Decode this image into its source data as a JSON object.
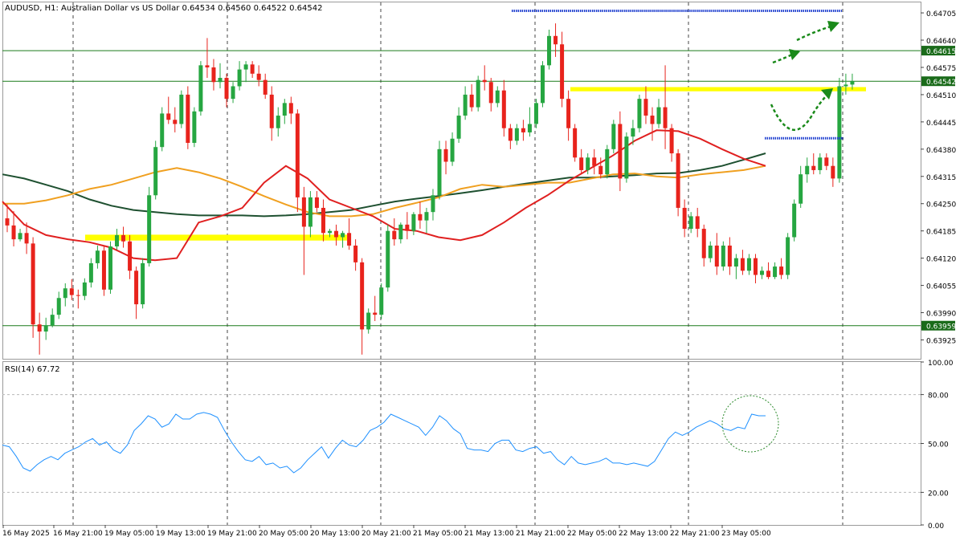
{
  "header": {
    "symbol_line": "AUDUSD, H1:  Australian Dollar vs US Dollar  0.64534 0.64560 0.64522 0.64542"
  },
  "rsi": {
    "label": "RSI(14) 67.72",
    "axis_ticks": [
      "100.00",
      "80.00",
      "50.00",
      "20.00",
      "0.00"
    ]
  },
  "price_axis": {
    "ticks": [
      "0.64705",
      "0.64640",
      "0.64575",
      "0.64510",
      "0.64445",
      "0.64380",
      "0.64315",
      "0.64250",
      "0.64185",
      "0.64120",
      "0.64055",
      "0.63990",
      "0.63925"
    ],
    "badges": [
      "0.64615",
      "0.64542",
      "0.63959"
    ]
  },
  "time_axis": {
    "labels": [
      "16 May 2025",
      "16 May 21:00",
      "19 May 05:00",
      "19 May 13:00",
      "19 May 21:00",
      "20 May 05:00",
      "20 May 13:00",
      "20 May 21:00",
      "21 May 05:00",
      "21 May 13:00",
      "21 May 21:00",
      "22 May 05:00",
      "22 May 13:00",
      "22 May 21:00",
      "23 May 05:00"
    ]
  },
  "colors": {
    "bull": "#26a641",
    "bear": "#e8231c",
    "ma_fast": "#e02020",
    "ma_mid": "#f0a020",
    "ma_slow": "#1e5030",
    "rsi_line": "#1e90ff",
    "zone": "#ffff00",
    "arrow": "#1a8a1a",
    "hline": "#1a7a1a"
  },
  "chart_data": {
    "type": "candlestick",
    "title": "AUDUSD, H1: Australian Dollar vs US Dollar",
    "last_ohlc": {
      "open": 0.64534,
      "high": 0.6456,
      "low": 0.64522,
      "close": 0.64542
    },
    "ylim": [
      0.6388,
      0.6473
    ],
    "horizontal_levels": [
      0.64615,
      0.64542,
      0.63959
    ],
    "candles": [
      [
        0.64215,
        0.64248,
        0.64182,
        0.64198
      ],
      [
        0.64198,
        0.64232,
        0.64148,
        0.64165
      ],
      [
        0.64165,
        0.6419,
        0.6416,
        0.6418
      ],
      [
        0.6418,
        0.64205,
        0.6413,
        0.64155
      ],
      [
        0.64155,
        0.6417,
        0.6393,
        0.63962
      ],
      [
        0.63962,
        0.6399,
        0.6389,
        0.63945
      ],
      [
        0.63945,
        0.63978,
        0.63925,
        0.6396
      ],
      [
        0.6396,
        0.64,
        0.63955,
        0.63985
      ],
      [
        0.63985,
        0.6404,
        0.63975,
        0.64025
      ],
      [
        0.64025,
        0.6406,
        0.64005,
        0.64048
      ],
      [
        0.64048,
        0.6407,
        0.6402,
        0.64032
      ],
      [
        0.64032,
        0.64045,
        0.64,
        0.6403
      ],
      [
        0.6403,
        0.64072,
        0.6402,
        0.64062
      ],
      [
        0.64062,
        0.6412,
        0.6405,
        0.64108
      ],
      [
        0.64108,
        0.6415,
        0.64095,
        0.64138
      ],
      [
        0.64138,
        0.6415,
        0.6403,
        0.64045
      ],
      [
        0.64045,
        0.6416,
        0.64035,
        0.64148
      ],
      [
        0.64148,
        0.6419,
        0.6414,
        0.64175
      ],
      [
        0.64175,
        0.64195,
        0.64145,
        0.6416
      ],
      [
        0.6416,
        0.64175,
        0.6407,
        0.6409
      ],
      [
        0.6409,
        0.641,
        0.63975,
        0.6401
      ],
      [
        0.6401,
        0.6412,
        0.64,
        0.64108
      ],
      [
        0.64108,
        0.6429,
        0.641,
        0.6427
      ],
      [
        0.6427,
        0.644,
        0.6426,
        0.64385
      ],
      [
        0.64385,
        0.6448,
        0.64375,
        0.64465
      ],
      [
        0.64465,
        0.64505,
        0.6444,
        0.6445
      ],
      [
        0.6445,
        0.6448,
        0.6442,
        0.6444
      ],
      [
        0.6444,
        0.6452,
        0.6443,
        0.6451
      ],
      [
        0.6451,
        0.6453,
        0.6438,
        0.64395
      ],
      [
        0.64395,
        0.6448,
        0.64385,
        0.6447
      ],
      [
        0.6447,
        0.6459,
        0.6446,
        0.6458
      ],
      [
        0.6458,
        0.64645,
        0.6455,
        0.64575
      ],
      [
        0.64575,
        0.64595,
        0.6452,
        0.6454
      ],
      [
        0.6454,
        0.64585,
        0.64525,
        0.6455
      ],
      [
        0.6455,
        0.6456,
        0.6448,
        0.645
      ],
      [
        0.645,
        0.6454,
        0.6449,
        0.6453
      ],
      [
        0.6453,
        0.6459,
        0.6452,
        0.6457
      ],
      [
        0.6457,
        0.6459,
        0.6454,
        0.64582
      ],
      [
        0.64582,
        0.6459,
        0.6455,
        0.6456
      ],
      [
        0.6456,
        0.6458,
        0.6453,
        0.64545
      ],
      [
        0.64545,
        0.6456,
        0.645,
        0.6451
      ],
      [
        0.6451,
        0.6453,
        0.644,
        0.6443
      ],
      [
        0.6443,
        0.6448,
        0.6441,
        0.6446
      ],
      [
        0.6446,
        0.645,
        0.6444,
        0.6449
      ],
      [
        0.6449,
        0.64505,
        0.6444,
        0.64465
      ],
      [
        0.64465,
        0.64475,
        0.6423,
        0.64265
      ],
      [
        0.64265,
        0.6429,
        0.6408,
        0.64195
      ],
      [
        0.64195,
        0.6428,
        0.6417,
        0.64265
      ],
      [
        0.64265,
        0.6428,
        0.6423,
        0.6424
      ],
      [
        0.6424,
        0.6426,
        0.6416,
        0.6418
      ],
      [
        0.6418,
        0.6419,
        0.6417,
        0.64185
      ],
      [
        0.64185,
        0.642,
        0.6415,
        0.6417
      ],
      [
        0.6417,
        0.64185,
        0.64145,
        0.6418
      ],
      [
        0.6418,
        0.64215,
        0.6414,
        0.6415
      ],
      [
        0.6415,
        0.64165,
        0.6409,
        0.6411
      ],
      [
        0.6411,
        0.6412,
        0.6389,
        0.6395
      ],
      [
        0.6395,
        0.64,
        0.6394,
        0.6399
      ],
      [
        0.6399,
        0.6403,
        0.6397,
        0.63985
      ],
      [
        0.63985,
        0.6406,
        0.63975,
        0.6405
      ],
      [
        0.6405,
        0.642,
        0.6404,
        0.64185
      ],
      [
        0.64185,
        0.64215,
        0.6415,
        0.64165
      ],
      [
        0.64165,
        0.64205,
        0.64155,
        0.642
      ],
      [
        0.642,
        0.6423,
        0.64165,
        0.64185
      ],
      [
        0.64185,
        0.6423,
        0.64175,
        0.64225
      ],
      [
        0.64225,
        0.64255,
        0.6419,
        0.6421
      ],
      [
        0.6421,
        0.6424,
        0.6418,
        0.6423
      ],
      [
        0.6423,
        0.64285,
        0.6421,
        0.6427
      ],
      [
        0.6427,
        0.644,
        0.6426,
        0.6438
      ],
      [
        0.6438,
        0.644,
        0.6432,
        0.6435
      ],
      [
        0.6435,
        0.6442,
        0.6434,
        0.64405
      ],
      [
        0.64405,
        0.6448,
        0.64395,
        0.6446
      ],
      [
        0.6446,
        0.6453,
        0.6445,
        0.6451
      ],
      [
        0.6451,
        0.64535,
        0.6447,
        0.6448
      ],
      [
        0.6448,
        0.64555,
        0.6447,
        0.64545
      ],
      [
        0.64545,
        0.6458,
        0.6452,
        0.6454
      ],
      [
        0.6454,
        0.6455,
        0.6447,
        0.6449
      ],
      [
        0.6449,
        0.6453,
        0.6448,
        0.6452
      ],
      [
        0.6452,
        0.64545,
        0.6441,
        0.6443
      ],
      [
        0.6443,
        0.6444,
        0.6438,
        0.644
      ],
      [
        0.644,
        0.6444,
        0.6439,
        0.6443
      ],
      [
        0.6443,
        0.6445,
        0.644,
        0.6442
      ],
      [
        0.6442,
        0.6448,
        0.6441,
        0.6444
      ],
      [
        0.6444,
        0.645,
        0.6443,
        0.6449
      ],
      [
        0.6449,
        0.6459,
        0.6448,
        0.6458
      ],
      [
        0.6458,
        0.64665,
        0.6457,
        0.6465
      ],
      [
        0.6465,
        0.6468,
        0.646,
        0.6463
      ],
      [
        0.6463,
        0.6466,
        0.6448,
        0.645
      ],
      [
        0.645,
        0.6452,
        0.644,
        0.6443
      ],
      [
        0.6443,
        0.6444,
        0.6435,
        0.6436
      ],
      [
        0.6436,
        0.6438,
        0.6432,
        0.6433
      ],
      [
        0.6433,
        0.6437,
        0.6432,
        0.6436
      ],
      [
        0.6436,
        0.6438,
        0.6432,
        0.6434
      ],
      [
        0.6434,
        0.6436,
        0.6431,
        0.6432
      ],
      [
        0.6432,
        0.6439,
        0.6431,
        0.6438
      ],
      [
        0.6438,
        0.6445,
        0.6437,
        0.6444
      ],
      [
        0.6444,
        0.6447,
        0.6428,
        0.6431
      ],
      [
        0.6431,
        0.6442,
        0.643,
        0.6441
      ],
      [
        0.6441,
        0.6445,
        0.6439,
        0.6443
      ],
      [
        0.6443,
        0.6451,
        0.6442,
        0.645
      ],
      [
        0.645,
        0.6453,
        0.6444,
        0.6446
      ],
      [
        0.6446,
        0.6448,
        0.644,
        0.6444
      ],
      [
        0.6444,
        0.645,
        0.6443,
        0.6448
      ],
      [
        0.6448,
        0.6458,
        0.6438,
        0.6443
      ],
      [
        0.6443,
        0.6444,
        0.6435,
        0.6437
      ],
      [
        0.6437,
        0.6438,
        0.6422,
        0.6424
      ],
      [
        0.6424,
        0.6426,
        0.6417,
        0.6419
      ],
      [
        0.6419,
        0.6423,
        0.6418,
        0.6422
      ],
      [
        0.6422,
        0.6424,
        0.6417,
        0.6419
      ],
      [
        0.6419,
        0.642,
        0.641,
        0.6412
      ],
      [
        0.6412,
        0.6416,
        0.6411,
        0.6415
      ],
      [
        0.6415,
        0.6418,
        0.6408,
        0.641
      ],
      [
        0.641,
        0.6416,
        0.6409,
        0.6415
      ],
      [
        0.6415,
        0.6417,
        0.6408,
        0.641
      ],
      [
        0.641,
        0.6413,
        0.6407,
        0.6412
      ],
      [
        0.6412,
        0.6414,
        0.6408,
        0.6409
      ],
      [
        0.6409,
        0.6413,
        0.6408,
        0.6412
      ],
      [
        0.6412,
        0.6413,
        0.6406,
        0.6408
      ],
      [
        0.6408,
        0.641,
        0.6407,
        0.6409
      ],
      [
        0.6409,
        0.6411,
        0.6407,
        0.64075
      ],
      [
        0.64075,
        0.6411,
        0.6407,
        0.641
      ],
      [
        0.641,
        0.6412,
        0.6407,
        0.6408
      ],
      [
        0.6408,
        0.6418,
        0.6407,
        0.6417
      ],
      [
        0.6417,
        0.6426,
        0.6416,
        0.6425
      ],
      [
        0.6425,
        0.6434,
        0.6424,
        0.6432
      ],
      [
        0.6432,
        0.6436,
        0.643,
        0.6434
      ],
      [
        0.6434,
        0.6437,
        0.6432,
        0.6433
      ],
      [
        0.6433,
        0.6437,
        0.6432,
        0.6436
      ],
      [
        0.6436,
        0.6437,
        0.6433,
        0.6434
      ],
      [
        0.6434,
        0.6436,
        0.6429,
        0.6431
      ],
      [
        0.6431,
        0.6455,
        0.643,
        0.6453
      ],
      [
        0.6453,
        0.6456,
        0.6451,
        0.64534
      ],
      [
        0.64534,
        0.6456,
        0.64522,
        0.64542
      ]
    ],
    "ma_fast": [
      0.64255,
      0.642,
      0.64175,
      0.64165,
      0.64158,
      0.64145,
      0.6412,
      0.64115,
      0.6412,
      0.64205,
      0.6422,
      0.6424,
      0.643,
      0.6434,
      0.6431,
      0.6426,
      0.6424,
      0.6422,
      0.6419,
      0.64185,
      0.6417,
      0.64163,
      0.64175,
      0.64205,
      0.6424,
      0.6427,
      0.64305,
      0.64335,
      0.64365,
      0.644,
      0.64425,
      0.64423,
      0.64405,
      0.6438,
      0.64357,
      0.6434
    ],
    "ma_mid": [
      0.6425,
      0.6425,
      0.64258,
      0.6427,
      0.64285,
      0.64295,
      0.6431,
      0.64325,
      0.64335,
      0.64325,
      0.6431,
      0.6429,
      0.64268,
      0.64248,
      0.6423,
      0.6422,
      0.6422,
      0.64225,
      0.6424,
      0.64252,
      0.64265,
      0.64285,
      0.64295,
      0.6429,
      0.64295,
      0.643,
      0.643,
      0.6431,
      0.6432,
      0.64322,
      0.64315,
      0.64312,
      0.6432,
      0.64325,
      0.6433,
      0.6434
    ],
    "ma_slow": [
      0.6432,
      0.6431,
      0.64295,
      0.6428,
      0.6426,
      0.64245,
      0.64235,
      0.6423,
      0.64225,
      0.64222,
      0.64222,
      0.64222,
      0.6422,
      0.64222,
      0.64225,
      0.6423,
      0.64235,
      0.64245,
      0.64255,
      0.64262,
      0.64268,
      0.64275,
      0.64282,
      0.6429,
      0.64298,
      0.64305,
      0.64312,
      0.64312,
      0.64315,
      0.64318,
      0.64322,
      0.64323,
      0.6433,
      0.6434,
      0.64355,
      0.6437
    ],
    "rsi": [
      49,
      48,
      42,
      35,
      33,
      37,
      40,
      42,
      40,
      44,
      46,
      48,
      51,
      53,
      49,
      51,
      46,
      44,
      49,
      58,
      62,
      67,
      65,
      60,
      62,
      68,
      65,
      65,
      68,
      69,
      68,
      66,
      58,
      51,
      45,
      40,
      39,
      42,
      37,
      38,
      35,
      36,
      32,
      35,
      40,
      44,
      48,
      41,
      47,
      52,
      49,
      48,
      52,
      58,
      60,
      63,
      68,
      66,
      64,
      62,
      60,
      55,
      60,
      67,
      64,
      59,
      56,
      47,
      46,
      46,
      45,
      50,
      52,
      52,
      46,
      45,
      47,
      48,
      44,
      45,
      40,
      37,
      42,
      38,
      37,
      38,
      39,
      41,
      38,
      38,
      37,
      38,
      37,
      36,
      39,
      46,
      53,
      57,
      55,
      57,
      60,
      62,
      64,
      62,
      59,
      58,
      60,
      59,
      68,
      67,
      67
    ],
    "rsi_levels": [
      80,
      50,
      20
    ],
    "rsi_ylim": [
      0,
      100
    ]
  }
}
